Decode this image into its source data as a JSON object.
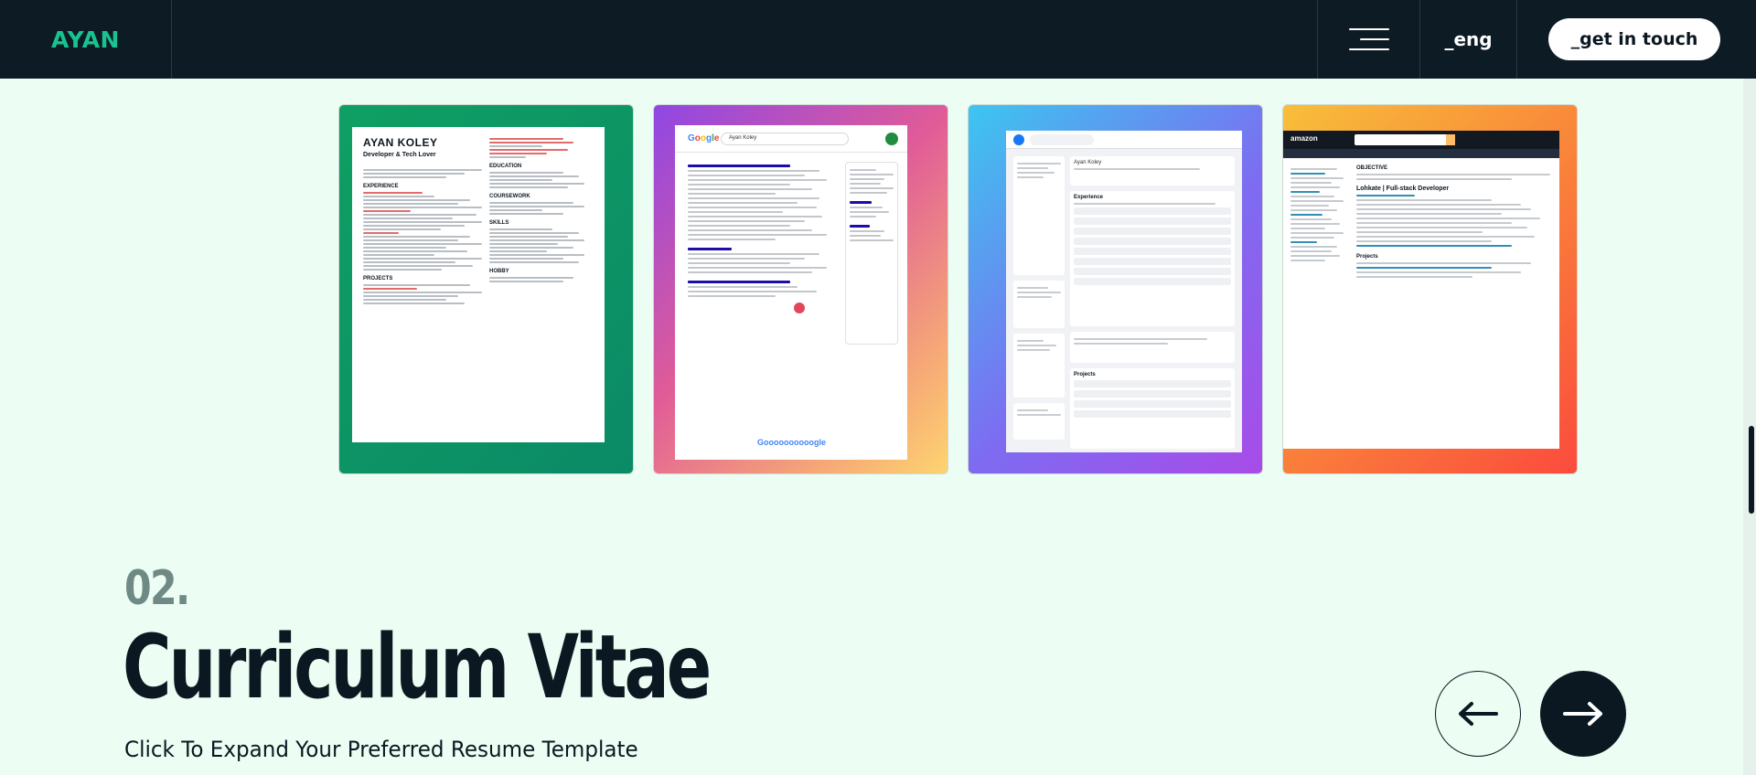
{
  "header": {
    "logo": "AYAN",
    "menu_icon": "hamburger-menu-icon",
    "language": "_eng",
    "cta_label": "_get in touch"
  },
  "templates": [
    {
      "label": "Classic resume template",
      "preview": {
        "name": "AYAN KOLEY",
        "role": "Developer & Tech Lover",
        "sections_left": [
          "EXPERIENCE",
          "PROJECTS"
        ],
        "sections_right": [
          "EDUCATION",
          "COURSEWORK",
          "SKILLS",
          "HOBBY"
        ]
      },
      "colors": {
        "from": "#0f9f63",
        "to": "#0b8a66"
      }
    },
    {
      "label": "Google style resume template",
      "preview": {
        "logo": "Google",
        "search": "Ayan Koley",
        "footer": "Goooooooooogle"
      },
      "colors": {
        "from": "#8f47e4",
        "to": "#fdd470"
      }
    },
    {
      "label": "Facebook style resume template",
      "preview": {
        "profile_name": "Ayan Koley",
        "sections": [
          "Experience",
          "Projects"
        ]
      },
      "colors": {
        "from": "#3cc6f0",
        "to": "#a94be8"
      }
    },
    {
      "label": "Amazon style resume template",
      "preview": {
        "logo": "amazon",
        "heading": "Lohkate | Full-stack Developer",
        "sections": [
          "OBJECTIVE",
          "Projects"
        ]
      },
      "colors": {
        "from": "#f8bf3a",
        "to": "#fb4b3d"
      }
    }
  ],
  "section": {
    "number": "02.",
    "title": "Curriculum Vitae",
    "subtitle": "Click To Expand Your Preferred Resume Template"
  },
  "navigation": {
    "prev_icon": "arrow-left-icon",
    "next_icon": "arrow-right-icon"
  }
}
